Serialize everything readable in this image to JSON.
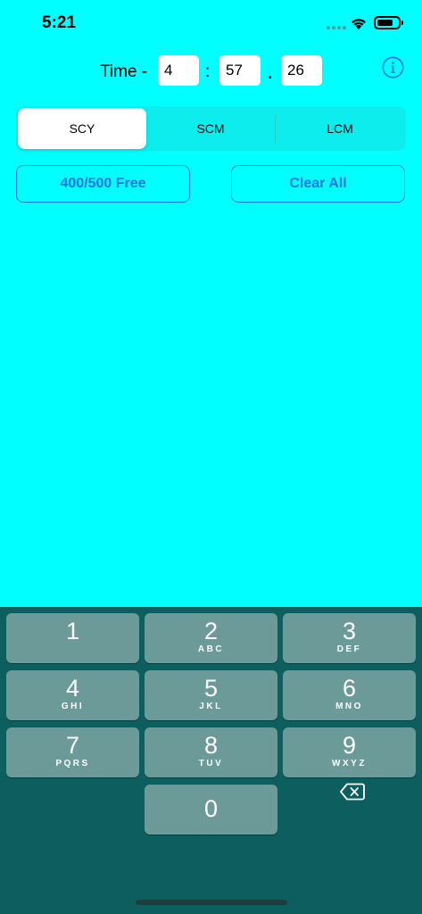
{
  "status_bar": {
    "time": "5:21"
  },
  "time_row": {
    "label": "Time -",
    "minutes": "4",
    "colon": ":",
    "seconds": "57",
    "dot": ".",
    "hundredths": "26"
  },
  "segments": [
    {
      "label": "SCY",
      "selected": true
    },
    {
      "label": "SCM",
      "selected": false
    },
    {
      "label": "LCM",
      "selected": false
    }
  ],
  "buttons": {
    "free": "400/500 Free",
    "clear": "Clear All"
  },
  "colors": {
    "background": "#00FFFF",
    "accent": "#1A73E8",
    "keyboard": "#0D5E5E",
    "key": "#6B9A98"
  },
  "keyboard": {
    "keys": [
      {
        "digit": "1",
        "letters": ""
      },
      {
        "digit": "2",
        "letters": "ABC"
      },
      {
        "digit": "3",
        "letters": "DEF"
      },
      {
        "digit": "4",
        "letters": "GHI"
      },
      {
        "digit": "5",
        "letters": "JKL"
      },
      {
        "digit": "6",
        "letters": "MNO"
      },
      {
        "digit": "7",
        "letters": "PQRS"
      },
      {
        "digit": "8",
        "letters": "TUV"
      },
      {
        "digit": "9",
        "letters": "WXYZ"
      },
      {
        "digit": "0",
        "letters": ""
      }
    ],
    "delete_icon": "backspace-icon"
  }
}
